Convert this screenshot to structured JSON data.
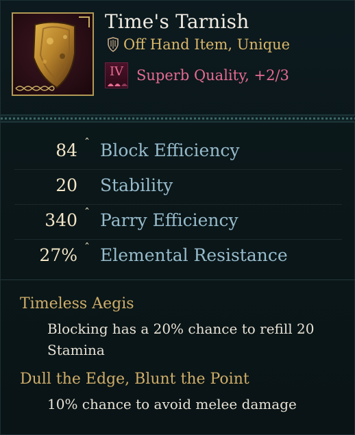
{
  "item": {
    "name": "Time's Tarnish",
    "type_line": "Off Hand Item, Unique",
    "type_icon": "shield-crest-icon",
    "quality": {
      "tier": "IV",
      "text": "Superb Quality, +2/3",
      "color": "#e66b91"
    },
    "portrait_icon": "kite-shield-icon",
    "frame_color": "#b39a55"
  },
  "stats": [
    {
      "value": "84",
      "caret": "ˆ",
      "label": "Block Efficiency"
    },
    {
      "value": "20",
      "caret": "",
      "label": "Stability"
    },
    {
      "value": "340",
      "caret": "ˆ",
      "label": "Parry Efficiency"
    },
    {
      "value": "27%",
      "caret": "ˆ",
      "label": "Elemental Resistance"
    }
  ],
  "perks": [
    {
      "title": "Timeless Aegis",
      "description": "Blocking has a 20% chance to refill 20 Stamina"
    },
    {
      "title": "Dull the Edge, Blunt the Point",
      "description": "10% chance to avoid melee damage"
    }
  ],
  "colors": {
    "background": "#0b1719",
    "title": "#f1ece2",
    "type": "#d9b76a",
    "stat_value": "#f3e6c7",
    "stat_label": "#97bccc",
    "perk_title": "#cfae6a",
    "perk_text": "#e7e2d6"
  }
}
